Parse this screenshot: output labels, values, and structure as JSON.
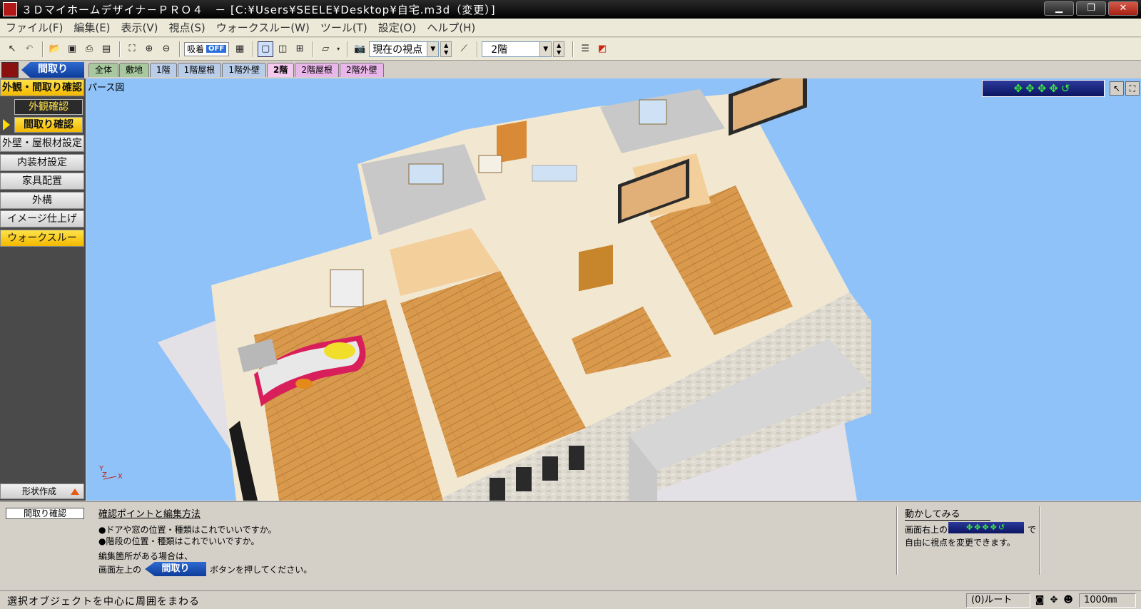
{
  "window": {
    "title": "３Ｄマイホームデザイナ－ＰＲＯ４　－ [C:¥Users¥SEELE¥Desktop¥自宅.m3d（変更）]",
    "minimize_label": "▁",
    "maximize_label": "❐",
    "close_label": "✕"
  },
  "menu": {
    "items": [
      "ファイル(F)",
      "編集(E)",
      "表示(V)",
      "視点(S)",
      "ウォークスルー(W)",
      "ツール(T)",
      "設定(O)",
      "ヘルプ(H)"
    ]
  },
  "toolbar": {
    "snap_label": "吸着",
    "snap_state": "OFF",
    "viewpoint_value": "現在の視点",
    "floor_value": "2階"
  },
  "tabs": {
    "madori_button": "間取り",
    "items": [
      {
        "label": "全体"
      },
      {
        "label": "敷地"
      },
      {
        "label": "1階"
      },
      {
        "label": "1階屋根"
      },
      {
        "label": "1階外壁"
      },
      {
        "label": "2階"
      },
      {
        "label": "2階屋根"
      },
      {
        "label": "2階外壁"
      }
    ]
  },
  "sidebar": {
    "items": [
      {
        "label": "外観・間取り確認"
      },
      {
        "label": "外観確認"
      },
      {
        "label": "間取り確認"
      },
      {
        "label": "外壁・屋根材設定"
      },
      {
        "label": "内装材設定"
      },
      {
        "label": "家具配置"
      },
      {
        "label": "外構"
      },
      {
        "label": "イメージ仕上げ"
      },
      {
        "label": "ウォークスルー"
      }
    ],
    "shape_button": "形状作成"
  },
  "viewport": {
    "label": "パース図",
    "axis_y": "Y",
    "axis_z": "Z",
    "axis_x": "X"
  },
  "info": {
    "mode": "間取り確認",
    "title": "確認ポイントと編集方法",
    "line1": "●ドアや窓の位置・種類はこれでいいですか。",
    "line2": "●階段の位置・種類はこれでいいですか。",
    "line3": "編集箇所がある場合は、",
    "line4_prefix": "画面左上の",
    "line4_button": "間取り",
    "line4_suffix": "ボタンを押してください。",
    "move_title": "動かしてみる",
    "move_line1_prefix": "画面右上の",
    "move_line1_suffix": "で",
    "move_line2": "自由に視点を変更できます。"
  },
  "status": {
    "text": "選択オブジェクトを中心に周囲をまわる",
    "route": "(0)ルート",
    "scale": "1000㎜"
  }
}
